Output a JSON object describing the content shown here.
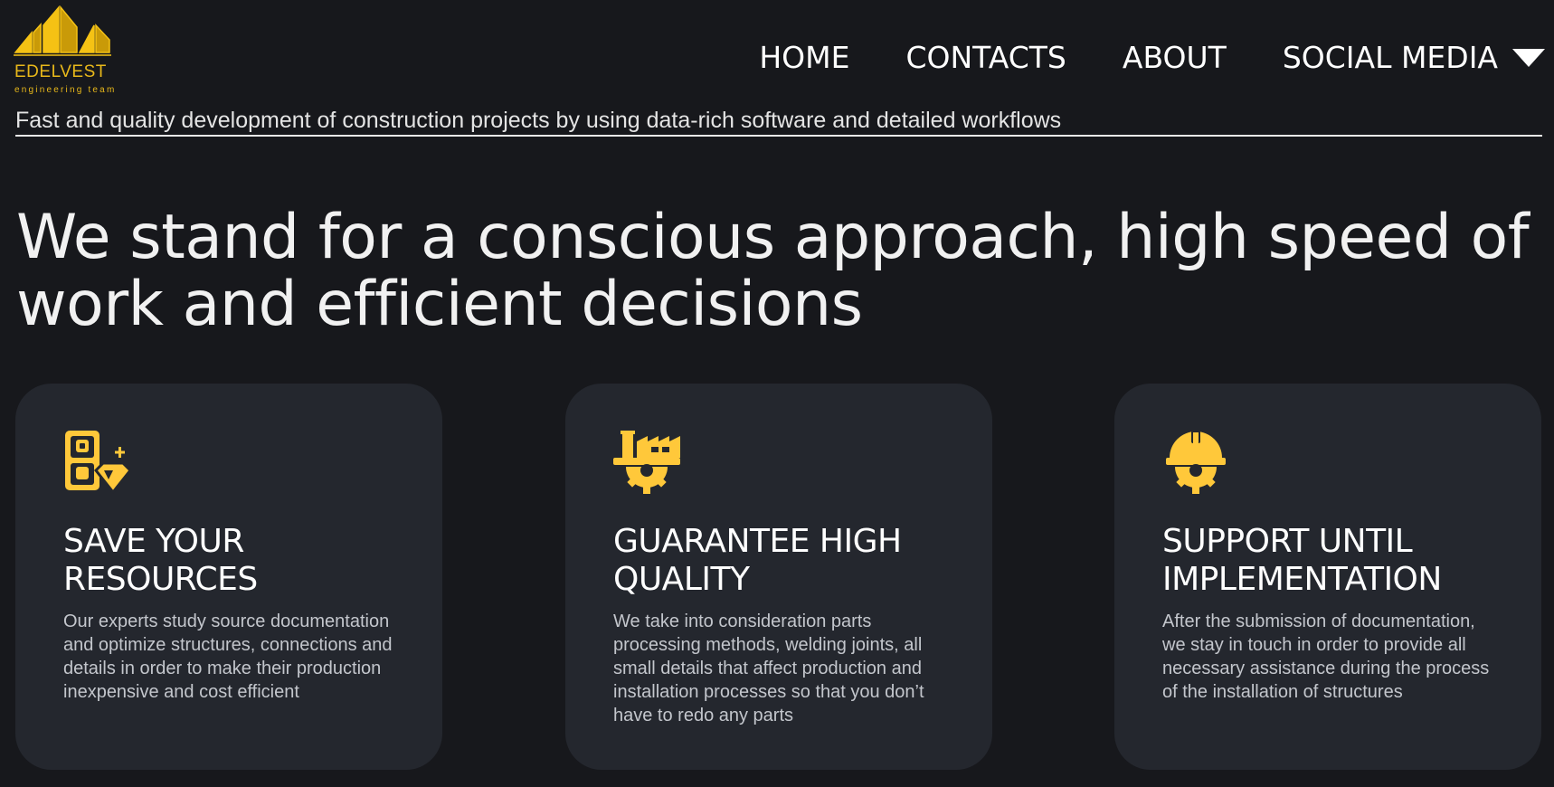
{
  "brand": {
    "name": "EDELVEST",
    "subtitle": "engineering team",
    "accent_color": "#f5c214"
  },
  "nav": {
    "items": [
      {
        "label": "HOME"
      },
      {
        "label": "CONTACTS"
      },
      {
        "label": "ABOUT"
      },
      {
        "label": "SOCIAL MEDIA",
        "icon": "caret-down-icon"
      }
    ]
  },
  "tagline": "Fast and quality development of construction projects by using data-rich software and detailed workflows",
  "hero": {
    "title": "We stand for a conscious approach, high speed of work and efficient decisions"
  },
  "cards": [
    {
      "icon": "safe-diamond-icon",
      "title": "SAVE YOUR RESOURCES",
      "text": "Our experts study source documentation and optimize structures, connections and details in order to make their production inexpensive and cost efficient"
    },
    {
      "icon": "factory-gear-icon",
      "title": "GUARANTEE HIGH QUALITY",
      "text": "We take into consideration parts processing methods, welding joints, all small details that affect production and installation processes so that you don’t have to redo any parts"
    },
    {
      "icon": "helmet-gear-icon",
      "title": "SUPPORT UNTIL IMPLEMENTATION",
      "text": "After the submission of documentation, we stay in touch in order to provide all necessary assistance during the process of the installation of structures"
    }
  ],
  "colors": {
    "background": "#17181c",
    "card_background": "#24272e",
    "icon": "#ffc83a"
  }
}
